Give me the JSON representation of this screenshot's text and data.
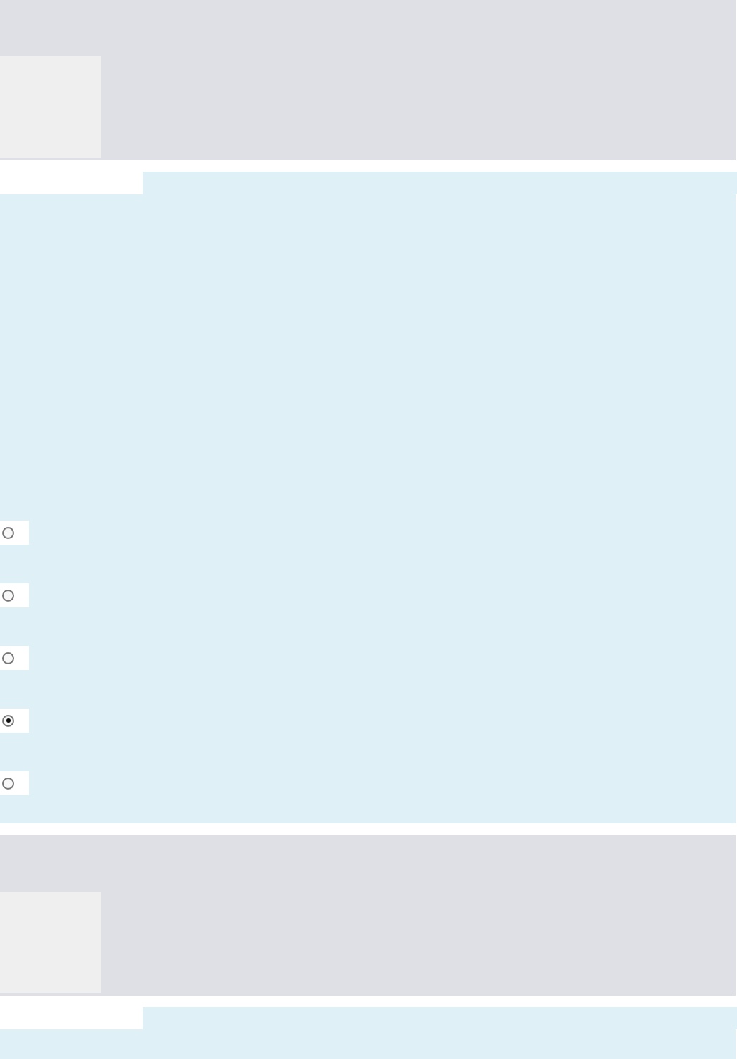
{
  "questions": [
    {
      "image": {
        "kind": "picture"
      },
      "options": [
        {
          "selected": false
        },
        {
          "selected": false
        },
        {
          "selected": false
        },
        {
          "selected": true
        },
        {
          "selected": false
        }
      ]
    },
    {
      "image": {
        "kind": "picture"
      }
    }
  ]
}
